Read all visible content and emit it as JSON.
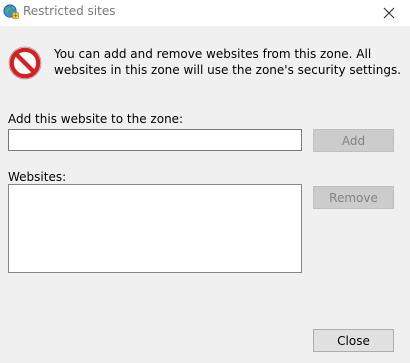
{
  "window": {
    "title": "Restricted sites",
    "icon": "globe-shield-icon",
    "close_icon": "close-icon"
  },
  "info": {
    "icon": "restricted-no-entry-icon",
    "icon_color": "#d81e1e",
    "text": "You can add and remove websites from this zone. All websites in this zone will use the zone's security settings."
  },
  "add_site": {
    "label": "Add this website to the zone:",
    "value": "",
    "placeholder": "",
    "button_label": "Add",
    "button_enabled": false
  },
  "websites": {
    "label": "Websites:",
    "items": [],
    "remove_label": "Remove",
    "remove_enabled": false
  },
  "footer": {
    "close_label": "Close"
  }
}
